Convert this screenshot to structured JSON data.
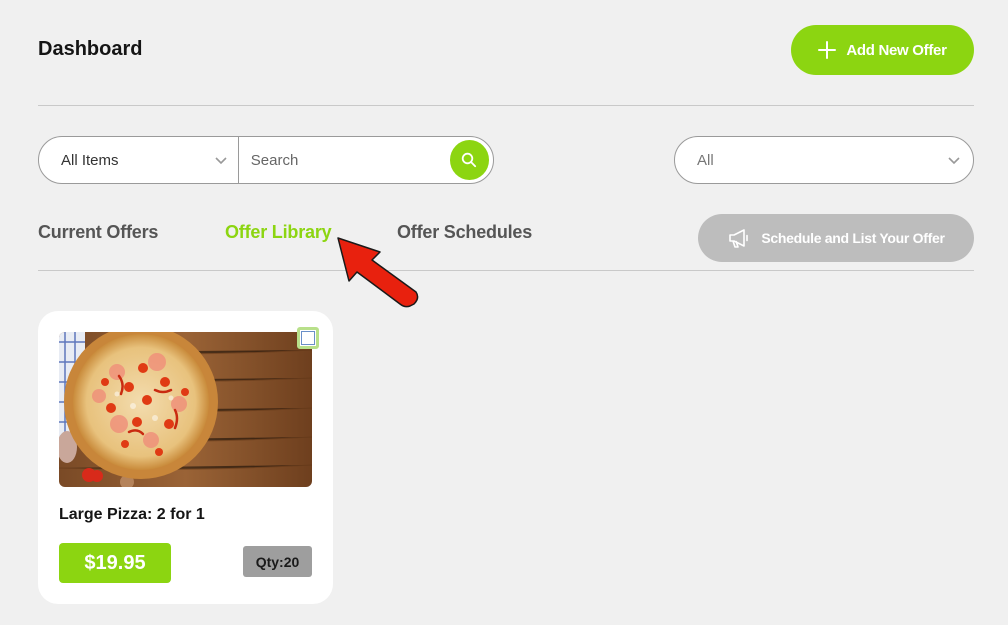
{
  "header": {
    "title": "Dashboard",
    "add_offer_label": "Add New Offer"
  },
  "filters": {
    "item_select_value": "All Items",
    "search_placeholder": "Search",
    "status_select_value": "All"
  },
  "tabs": [
    {
      "label": "Current Offers",
      "active": false
    },
    {
      "label": "Offer Library",
      "active": true
    },
    {
      "label": "Offer Schedules",
      "active": false
    }
  ],
  "schedule_button_label": "Schedule and List Your Offer",
  "offers": [
    {
      "title": "Large Pizza: 2 for 1",
      "price": "$19.95",
      "qty": "Qty:20",
      "checked": false
    }
  ],
  "colors": {
    "accent": "#8cd511",
    "disabled": "#bdbdbd",
    "annotation_arrow": "#e8210e"
  },
  "icons": {
    "add": "plus-icon",
    "search": "search-icon",
    "dropdown": "chevron-down-icon",
    "schedule": "megaphone-icon"
  }
}
